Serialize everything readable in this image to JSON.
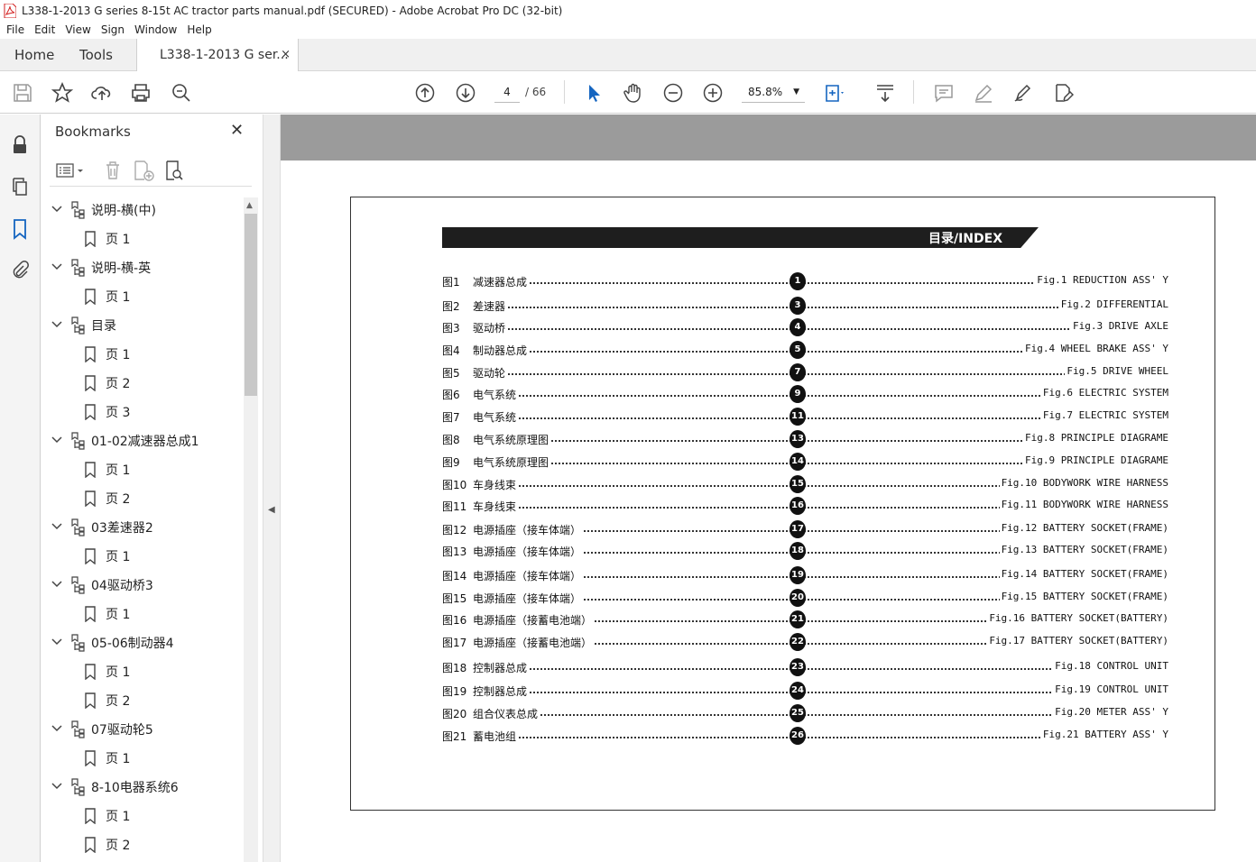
{
  "window": {
    "title": "L338-1-2013 G series 8-15t AC tractor parts manual.pdf (SECURED) - Adobe Acrobat Pro DC (32-bit)"
  },
  "menu": [
    "File",
    "Edit",
    "View",
    "Sign",
    "Window",
    "Help"
  ],
  "tabs": {
    "home": "Home",
    "tools": "Tools",
    "document": "L338-1-2013 G ser...",
    "close": "×"
  },
  "toolbar": {
    "page_current": "4",
    "page_total": "/ 66",
    "zoom": "85.8%"
  },
  "bookmarks": {
    "title": "Bookmarks",
    "items": [
      {
        "label": "说明-横(中)",
        "level": 0
      },
      {
        "label": "页 1",
        "level": 1
      },
      {
        "label": "说明-横-英",
        "level": 0
      },
      {
        "label": "页 1",
        "level": 1
      },
      {
        "label": "目录",
        "level": 0
      },
      {
        "label": "页 1",
        "level": 1
      },
      {
        "label": "页 2",
        "level": 1
      },
      {
        "label": "页 3",
        "level": 1
      },
      {
        "label": "01-02减速器总成1",
        "level": 0
      },
      {
        "label": "页 1",
        "level": 1
      },
      {
        "label": "页 2",
        "level": 1
      },
      {
        "label": "03差速器2",
        "level": 0
      },
      {
        "label": "页 1",
        "level": 1
      },
      {
        "label": "04驱动桥3",
        "level": 0
      },
      {
        "label": "页 1",
        "level": 1
      },
      {
        "label": "05-06制动器4",
        "level": 0
      },
      {
        "label": "页 1",
        "level": 1
      },
      {
        "label": "页 2",
        "level": 1
      },
      {
        "label": "07驱动轮5",
        "level": 0
      },
      {
        "label": "页 1",
        "level": 1
      },
      {
        "label": "8-10电器系统6",
        "level": 0
      },
      {
        "label": "页 1",
        "level": 1
      },
      {
        "label": "页 2",
        "level": 1
      }
    ]
  },
  "document": {
    "banner": "目录/INDEX",
    "index": [
      {
        "fig": "图1",
        "zh": "减速器总成",
        "num": "1",
        "en": "Fig.1 REDUCTION ASS' Y"
      },
      {
        "fig": "图2",
        "zh": "差速器",
        "num": "3",
        "en": "Fig.2 DIFFERENTIAL"
      },
      {
        "fig": "图3",
        "zh": "驱动桥",
        "num": "4",
        "en": "Fig.3 DRIVE AXLE"
      },
      {
        "fig": "图4",
        "zh": "制动器总成",
        "num": "5",
        "en": "Fig.4 WHEEL BRAKE ASS' Y"
      },
      {
        "fig": "图5",
        "zh": "驱动轮",
        "num": "7",
        "en": "Fig.5 DRIVE WHEEL"
      },
      {
        "fig": "图6",
        "zh": "电气系统",
        "num": "9",
        "en": "Fig.6 ELECTRIC SYSTEM"
      },
      {
        "fig": "图7",
        "zh": "电气系统",
        "num": "11",
        "en": "Fig.7 ELECTRIC SYSTEM"
      },
      {
        "fig": "图8",
        "zh": "电气系统原理图",
        "num": "13",
        "en": "Fig.8 PRINCIPLE DIAGRAME"
      },
      {
        "fig": "图9",
        "zh": "电气系统原理图",
        "num": "14",
        "en": "Fig.9 PRINCIPLE DIAGRAME"
      },
      {
        "fig": "图10",
        "zh": "车身线束",
        "num": "15",
        "en": "Fig.10 BODYWORK WIRE HARNESS"
      },
      {
        "fig": "图11",
        "zh": "车身线束",
        "num": "16",
        "en": "Fig.11 BODYWORK WIRE HARNESS"
      },
      {
        "fig": "图12",
        "zh": "电源插座（接车体端）",
        "num": "17",
        "en": "Fig.12 BATTERY SOCKET(FRAME)"
      },
      {
        "fig": "图13",
        "zh": "电源插座（接车体端）",
        "num": "18",
        "en": "Fig.13 BATTERY SOCKET(FRAME)"
      },
      {
        "fig": "图14",
        "zh": "电源插座（接车体端）",
        "num": "19",
        "en": "Fig.14 BATTERY SOCKET(FRAME)"
      },
      {
        "fig": "图15",
        "zh": "电源插座（接车体端）",
        "num": "20",
        "en": "Fig.15 BATTERY SOCKET(FRAME)"
      },
      {
        "fig": "图16",
        "zh": "电源插座（接蓄电池端）",
        "num": "21",
        "en": "Fig.16 BATTERY SOCKET(BATTERY)"
      },
      {
        "fig": "图17",
        "zh": "电源插座（接蓄电池端）",
        "num": "22",
        "en": "Fig.17 BATTERY SOCKET(BATTERY)"
      },
      {
        "fig": "图18",
        "zh": "控制器总成",
        "num": "23",
        "en": "Fig.18 CONTROL UNIT"
      },
      {
        "fig": "图19",
        "zh": "控制器总成",
        "num": "24",
        "en": "Fig.19 CONTROL UNIT"
      },
      {
        "fig": "图20",
        "zh": "组合仪表总成",
        "num": "25",
        "en": "Fig.20 METER ASS' Y"
      },
      {
        "fig": "图21",
        "zh": "蓄电池组",
        "num": "26",
        "en": "Fig.21 BATTERY ASS' Y"
      }
    ]
  }
}
